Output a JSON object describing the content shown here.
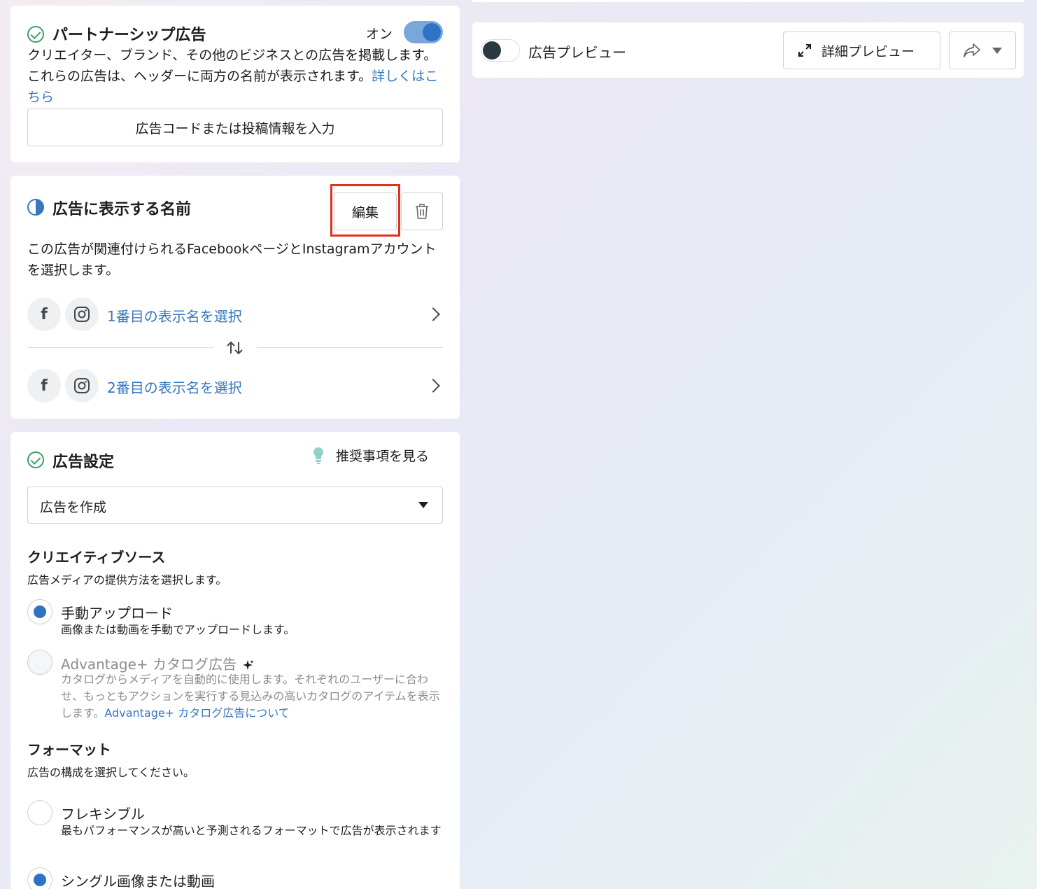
{
  "partnership": {
    "title": "パートナーシップ広告",
    "toggle_label": "オン",
    "description": "クリエイター、ブランド、その他のビジネスとの広告を掲載します。これらの広告は、ヘッダーに両方の名前が表示されます。",
    "learn_more": "詳しくはこちら",
    "input_button": "広告コードまたは投稿情報を入力"
  },
  "display_name": {
    "title": "広告に表示する名前",
    "edit_button": "編集",
    "description": "この広告が関連付けられるFacebookページとInstagramアカウントを選択します。",
    "first_row": "1番目の表示名を選択",
    "second_row": "2番目の表示名を選択",
    "facebook_letter": "f"
  },
  "ad_settings": {
    "title": "広告設定",
    "recommendations": "推奨事項を見る",
    "select_value": "広告を作成",
    "creative_source": {
      "title": "クリエイティブソース",
      "subtitle": "広告メディアの提供方法を選択します。",
      "options": [
        {
          "label": "手動アップロード",
          "desc": "画像または動画を手動でアップロードします。",
          "selected": true
        },
        {
          "label": "Advantage+ カタログ広告",
          "desc": "カタログからメディアを自動的に使用します。それぞれのユーザーに合わせ、もっともアクションを実行する見込みの高いカタログのアイテムを表示します。",
          "link": "Advantage+ カタログ広告について",
          "selected": false
        }
      ]
    },
    "format": {
      "title": "フォーマット",
      "subtitle": "広告の構成を選択してください。",
      "options": [
        {
          "label": "フレキシブル",
          "desc": "最もパフォーマンスが高いと予測されるフォーマットで広告が表示されます",
          "selected": false
        },
        {
          "label": "シングル画像または動画",
          "selected": true
        }
      ]
    }
  },
  "preview": {
    "label": "広告プレビュー",
    "detail_button": "詳細プレビュー"
  },
  "colors": {
    "accent_blue": "#3578bf",
    "toggle_on": "#2f73c4",
    "check_green": "#3d9c6a",
    "highlight_red": "#e0311f"
  }
}
